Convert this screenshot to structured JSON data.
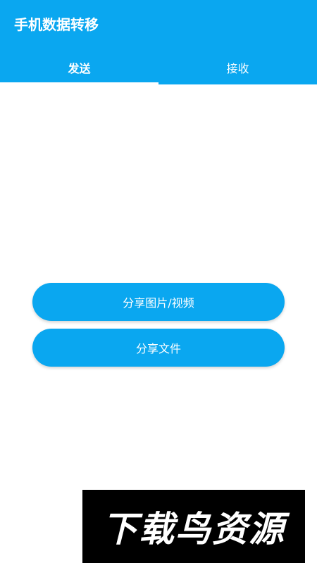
{
  "app": {
    "title": "手机数据转移"
  },
  "tabs": [
    {
      "label": "发送",
      "active": true
    },
    {
      "label": "接收",
      "active": false
    }
  ],
  "actions": {
    "share_media_label": "分享图片/视频",
    "share_file_label": "分享文件"
  },
  "watermark": {
    "text": "下载鸟资源"
  },
  "colors": {
    "primary": "#0aa7f0",
    "on_primary": "#ffffff",
    "background": "#ffffff"
  }
}
